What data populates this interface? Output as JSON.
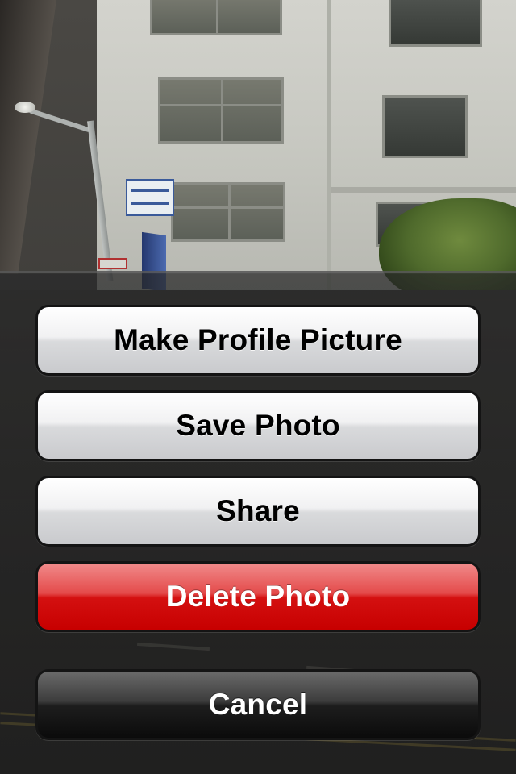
{
  "action_sheet": {
    "buttons": [
      {
        "label": "Make Profile Picture",
        "style": "default"
      },
      {
        "label": "Save Photo",
        "style": "default"
      },
      {
        "label": "Share",
        "style": "default"
      },
      {
        "label": "Delete Photo",
        "style": "destructive"
      }
    ],
    "cancel_label": "Cancel"
  },
  "colors": {
    "destructive": "#d41010",
    "default_button": "#e6e6e8",
    "cancel_button": "#1d1d1d"
  }
}
